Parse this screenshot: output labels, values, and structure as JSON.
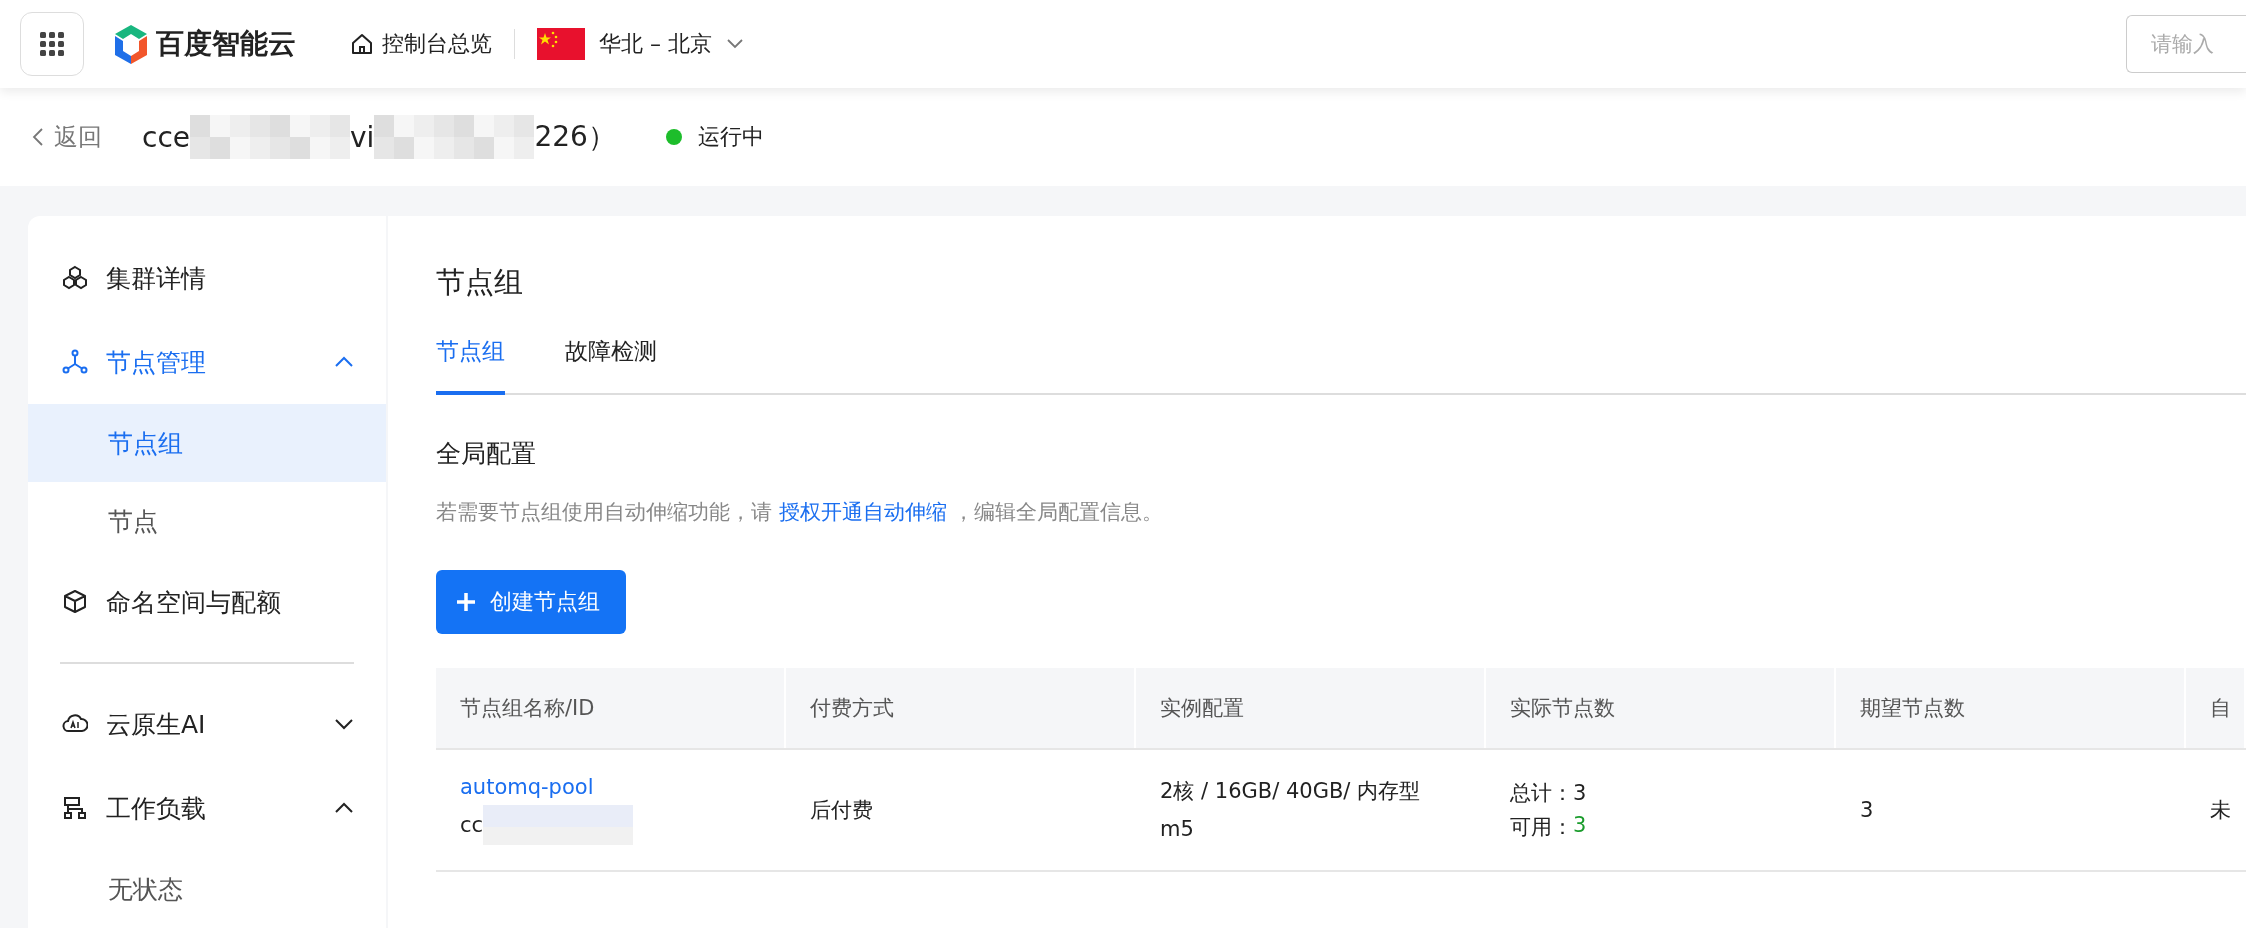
{
  "topbar": {
    "brand": "百度智能云",
    "overview": "控制台总览",
    "region": "华北 – 北京",
    "search": {
      "placeholder": "请输入"
    }
  },
  "header": {
    "back": "返回",
    "title_parts": [
      {
        "kind": "text",
        "text": "cce"
      },
      {
        "kind": "mask"
      },
      {
        "kind": "text",
        "text": "vi"
      },
      {
        "kind": "mask"
      },
      {
        "kind": "text",
        "text": "226）"
      }
    ],
    "status": {
      "label": "运行中",
      "color": "#1dbd2b"
    }
  },
  "sidebar": {
    "items": [
      {
        "label": "集群详情",
        "selected": false
      },
      {
        "label": "节点管理",
        "expanded": true,
        "selected": true,
        "children": [
          {
            "label": "节点组",
            "selected": true
          },
          {
            "label": "节点",
            "selected": false
          }
        ]
      },
      {
        "label": "命名空间与配额",
        "selected": false
      },
      {
        "kind": "divider"
      },
      {
        "label": "云原生AI",
        "expanded": false,
        "selected": false
      },
      {
        "label": "工作负载",
        "expanded": true,
        "selected": false,
        "children": [
          {
            "label": "无状态",
            "selected": false
          }
        ]
      }
    ]
  },
  "main": {
    "title": "节点组",
    "tabs": [
      {
        "label": "节点组",
        "selected": true
      },
      {
        "label": "故障检测",
        "selected": false
      }
    ],
    "section": "全局配置",
    "hint": {
      "before": "若需要节点组使用自动伸缩功能，请",
      "link": "授权开通自动伸缩",
      "after": "，编辑全局配置信息。"
    },
    "create_button": "创建节点组",
    "table": {
      "columns": [
        "节点组名称/ID",
        "付费方式",
        "实例配置",
        "实际节点数",
        "期望节点数",
        "自"
      ],
      "rows": [
        {
          "name": "automq-pool",
          "id": "cc",
          "billing": "后付费",
          "config": "2核 / 16GB/ 40GB/ 内存型 m5",
          "total": "总计：3",
          "available_label": "可用：",
          "available": "3",
          "desired": "3",
          "column_6": "未"
        }
      ]
    }
  }
}
